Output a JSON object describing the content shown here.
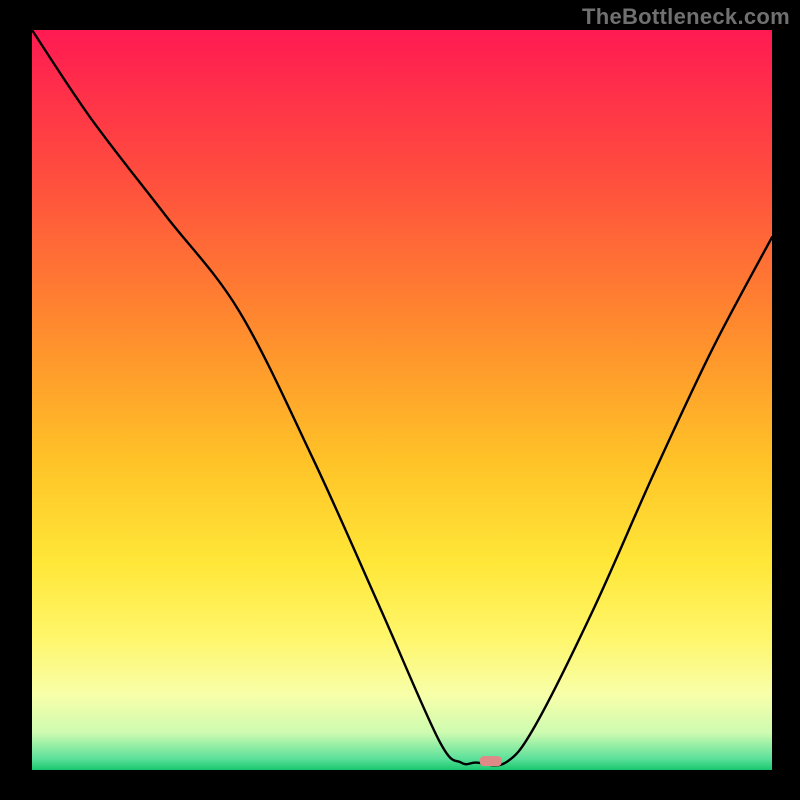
{
  "watermark": "TheBottleneck.com",
  "chart_data": {
    "type": "line",
    "title": "",
    "xlabel": "",
    "ylabel": "",
    "xlim": [
      0,
      100
    ],
    "ylim": [
      0,
      100
    ],
    "grid": false,
    "legend": false,
    "annotations": [],
    "series": [
      {
        "name": "bottleneck-curve",
        "x": [
          0,
          8,
          18,
          28,
          38,
          47,
          55,
          58,
          60,
          64,
          68,
          76,
          84,
          92,
          100
        ],
        "y": [
          100,
          88,
          75,
          62,
          42,
          22,
          4,
          1,
          1,
          1,
          6,
          22,
          40,
          57,
          72
        ]
      }
    ],
    "marker": {
      "x": 62,
      "y": 1.2,
      "color": "#e08a88"
    },
    "background_gradient": {
      "stops": [
        {
          "offset": 0.0,
          "color": "#ff1a52"
        },
        {
          "offset": 0.2,
          "color": "#ff4e3e"
        },
        {
          "offset": 0.4,
          "color": "#ff8a2e"
        },
        {
          "offset": 0.58,
          "color": "#ffc227"
        },
        {
          "offset": 0.72,
          "color": "#ffe738"
        },
        {
          "offset": 0.82,
          "color": "#fff66a"
        },
        {
          "offset": 0.9,
          "color": "#f7ffaa"
        },
        {
          "offset": 0.95,
          "color": "#cdfbb0"
        },
        {
          "offset": 0.985,
          "color": "#5be09a"
        },
        {
          "offset": 1.0,
          "color": "#18c76f"
        }
      ]
    }
  }
}
